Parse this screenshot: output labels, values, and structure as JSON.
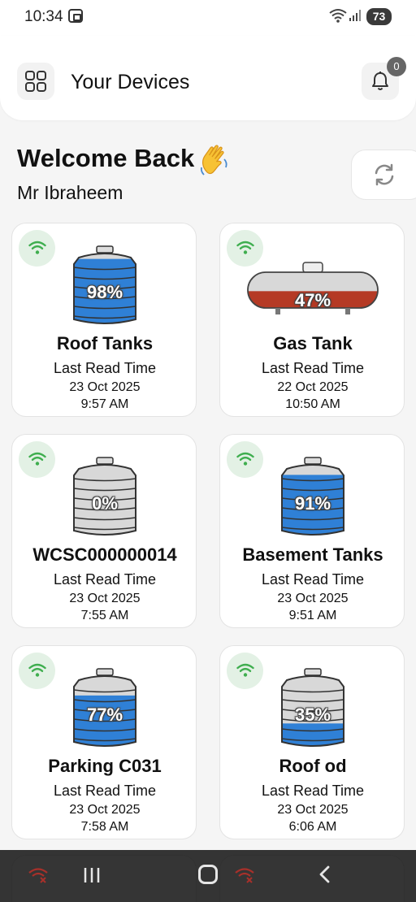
{
  "status_bar": {
    "time": "10:34",
    "battery": "73"
  },
  "header": {
    "title": "Your Devices",
    "notification_count": "0"
  },
  "welcome": {
    "heading": "Welcome Back",
    "user": "Mr Ibraheem"
  },
  "devices": [
    {
      "name": "Roof Tanks",
      "percent": "98%",
      "fill": 0.98,
      "tank_type": "water-tank",
      "connection": "online",
      "last_read_label": "Last Read Time",
      "date": "23 Oct 2025",
      "time": "9:57 AM"
    },
    {
      "name": "Gas Tank",
      "percent": "47%",
      "fill": 0.47,
      "tank_type": "gas-tank",
      "connection": "online",
      "last_read_label": "Last Read Time",
      "date": "22 Oct 2025",
      "time": "10:50 AM"
    },
    {
      "name": "WCSC000000014",
      "percent": "0%",
      "fill": 0.0,
      "tank_type": "water-tank",
      "connection": "online",
      "last_read_label": "Last Read Time",
      "date": "23 Oct 2025",
      "time": "7:55 AM"
    },
    {
      "name": "Basement Tanks",
      "percent": "91%",
      "fill": 0.91,
      "tank_type": "water-tank",
      "connection": "online",
      "last_read_label": "Last Read Time",
      "date": "23 Oct 2025",
      "time": "9:51 AM"
    },
    {
      "name": "Parking C031",
      "percent": "77%",
      "fill": 0.77,
      "tank_type": "water-tank",
      "connection": "online",
      "last_read_label": "Last Read Time",
      "date": "23 Oct 2025",
      "time": "7:58 AM"
    },
    {
      "name": "Roof od",
      "percent": "35%",
      "fill": 0.35,
      "tank_type": "water-tank",
      "connection": "online",
      "last_read_label": "Last Read Time",
      "date": "23 Oct 2025",
      "time": "6:06 AM"
    }
  ],
  "colors": {
    "water": "#2f80d6",
    "gas": "#b53a25",
    "empty": "#d8d8d8",
    "wifi_online": "#3fae4f",
    "wifi_offline": "#d0342c"
  },
  "icons": {
    "menu": "grid-icon",
    "notification": "bell-icon",
    "refresh": "refresh-icon",
    "greeting": "waving-hand-icon",
    "connection": "wifi-icon"
  }
}
